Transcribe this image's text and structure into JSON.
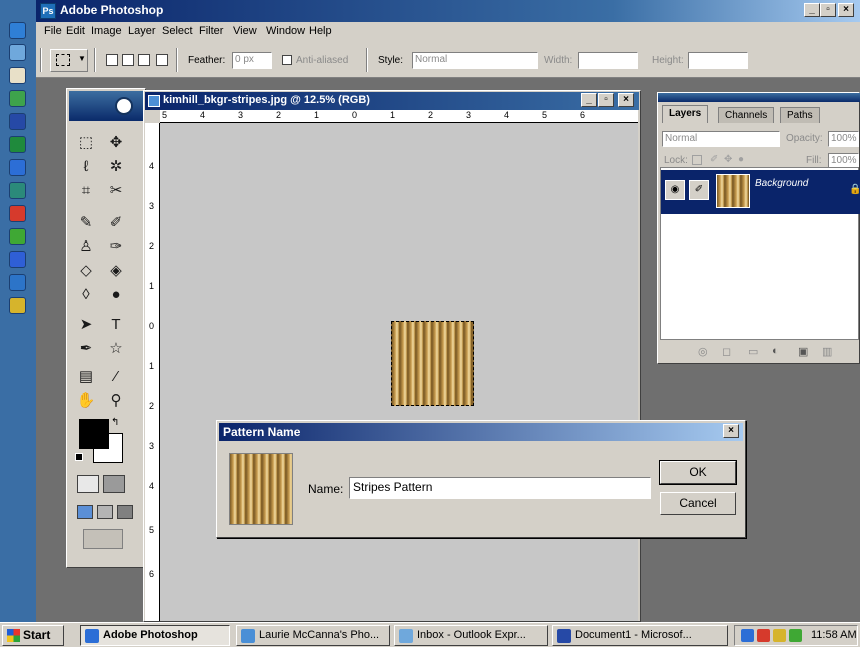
{
  "app": {
    "title": "Adobe Photoshop",
    "icon": "photoshop-icon",
    "window_buttons": [
      "_",
      "▫",
      "×"
    ]
  },
  "menu": [
    "File",
    "Edit",
    "Image",
    "Layer",
    "Select",
    "Filter",
    "View",
    "Window",
    "Help"
  ],
  "options_bar": {
    "feather_label": "Feather:",
    "feather_value": "0 px",
    "anti_aliased_label": "Anti-aliased",
    "style_label": "Style:",
    "style_value": "Normal",
    "width_label": "Width:",
    "height_label": "Height:"
  },
  "document": {
    "title": "kimhill_bkgr-stripes.jpg @ 12.5% (RGB)",
    "ruler_top": [
      "5",
      "4",
      "3",
      "2",
      "1",
      "0",
      "1",
      "2",
      "3",
      "4",
      "5",
      "6"
    ],
    "ruler_left": [
      "4",
      "3",
      "2",
      "1",
      "0",
      "1",
      "2",
      "3",
      "4",
      "5",
      "6"
    ]
  },
  "layers_panel": {
    "tabs": [
      "Layers",
      "Channels",
      "Paths"
    ],
    "blend_mode": "Normal",
    "opacity_label": "Opacity:",
    "opacity_value": "100%",
    "lock_label": "Lock:",
    "fill_label": "Fill:",
    "fill_value": "100%",
    "layer_name": "Background"
  },
  "dialog": {
    "title": "Pattern Name",
    "close": "×",
    "name_label": "Name:",
    "name_value": "Stripes Pattern",
    "ok_label": "OK",
    "cancel_label": "Cancel"
  },
  "taskbar": {
    "start_label": "Start",
    "buttons": [
      "Adobe Photoshop",
      "Laurie McCanna's Pho...",
      "Inbox - Outlook Expr...",
      "Document1 - Microsof..."
    ],
    "clock": "11:58 AM"
  },
  "colors": {
    "title_bar": "#0a246a",
    "chrome": "#d4d0c8",
    "workspace": "#6f6f6f"
  }
}
